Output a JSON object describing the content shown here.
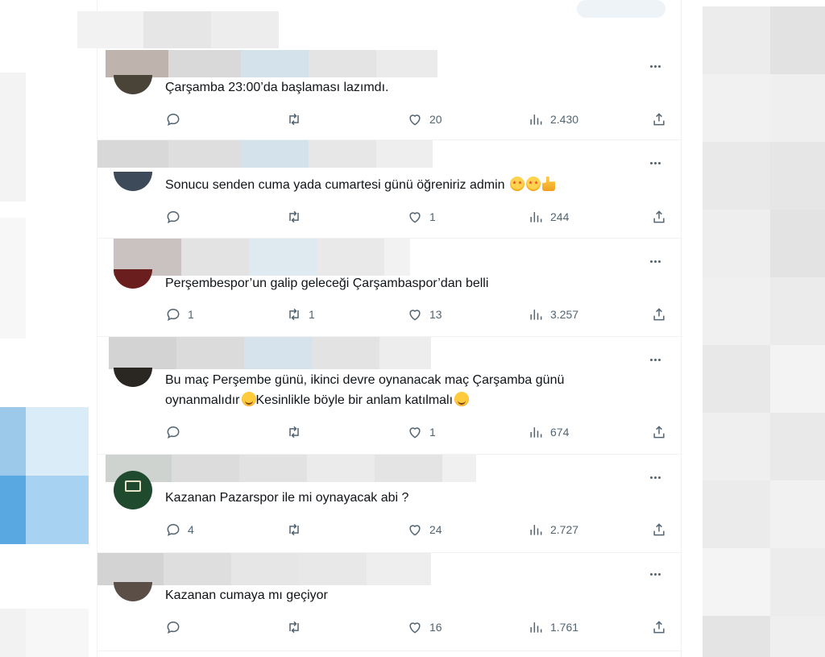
{
  "tweets": [
    {
      "text": "Çarşamba 23:00’da başlaması lazımdı.",
      "reply_count": "",
      "retweet_count": "",
      "like_count": "20",
      "view_count": "2.430",
      "avatar_color": "#4a4438"
    },
    {
      "text": "Sonucu senden cuma yada cumartesi  günü öğreniriz admin",
      "emojis": [
        "star-struck",
        "star-struck",
        "thumbs-up"
      ],
      "reply_count": "",
      "retweet_count": "",
      "like_count": "1",
      "view_count": "244",
      "avatar_color": "#3c4a5a"
    },
    {
      "text": "Perşembespor’un galip geleceği Çarşambaspor’dan belli",
      "reply_count": "1",
      "retweet_count": "1",
      "like_count": "13",
      "view_count": "3.257",
      "avatar_color": "#6a1e1e"
    },
    {
      "text_line1": "Bu maç Perşembe günü, ikinci devre oynanacak maç Çarşamba günü",
      "text_line2a": "oynanmalıdır",
      "text_line2b": "Kesinlikle böyle bir anlam katılmalı",
      "emojis": [
        "smiling-face",
        "smiling-face"
      ],
      "reply_count": "",
      "retweet_count": "",
      "like_count": "1",
      "view_count": "674",
      "avatar_color": "#2a2622"
    },
    {
      "text": "Kazanan Pazarspor ile mi oynayacak abi ?",
      "reply_count": "4",
      "retweet_count": "",
      "like_count": "24",
      "view_count": "2.727",
      "avatar_color": "#1f4a2e"
    },
    {
      "text": "Kazanan cumaya mı geçiyor",
      "reply_count": "",
      "retweet_count": "",
      "like_count": "16",
      "view_count": "1.761",
      "avatar_color": "#5a4e46"
    }
  ],
  "colors": {
    "text_primary": "#0f1419",
    "text_secondary": "#536471",
    "divider": "#eff3f4"
  },
  "icons": [
    "more-icon",
    "reply-icon",
    "retweet-icon",
    "like-icon",
    "views-icon",
    "share-icon"
  ]
}
